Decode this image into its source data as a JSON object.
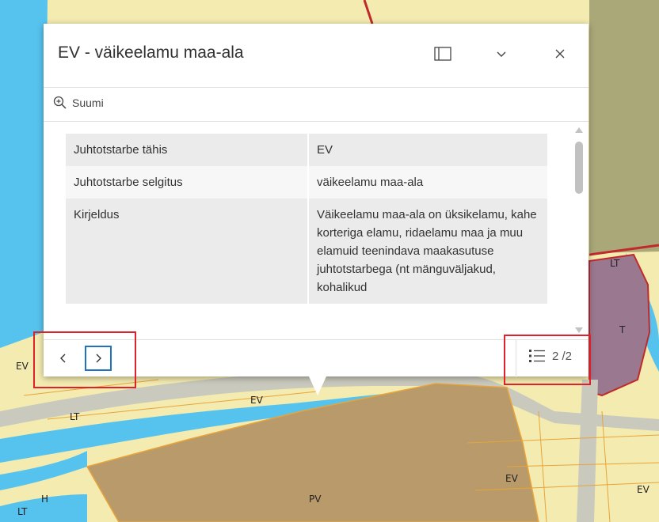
{
  "popup": {
    "title": "EV - väikeelamu maa-ala",
    "header_icons": [
      "dock-panel-icon",
      "collapse-chevron-icon",
      "close-icon"
    ],
    "zoom_label": "Suumi",
    "zoom_icon": "zoom-in-icon",
    "attributes": [
      {
        "key": "Juhtotstarbe tähis",
        "value": "EV"
      },
      {
        "key": "Juhtotstarbe selgitus",
        "value": "väikeelamu maa-ala"
      },
      {
        "key": "Kirjeldus",
        "value": "Väikeelamu maa-ala on üksikelamu, kahe korteriga elamu, ridaelamu maa ja muu elamuid teenindava maakasutuse juhtotstarbega (nt mänguväljakud, kohalikud"
      }
    ],
    "footer": {
      "prev_icon": "chevron-left-icon",
      "next_icon": "chevron-right-icon",
      "list_icon": "feature-list-icon",
      "pager_text": "2 /2"
    }
  },
  "map": {
    "labels": [
      "EV",
      "LT",
      "EV",
      "LT",
      "T",
      "EV",
      "PV",
      "EV",
      "H",
      "LT"
    ],
    "colors": {
      "residential": "#f3ebb0",
      "green": "#aaa878",
      "water": "#56c3ef",
      "brown": "#b99a6b",
      "purple": "#9a7890",
      "road": "#c9c9bd",
      "boundary_red": "#c02a2a",
      "parcel_orange": "#e8a43a"
    }
  },
  "highlight_color": "#e0202a",
  "active_button_color": "#1e72c0"
}
